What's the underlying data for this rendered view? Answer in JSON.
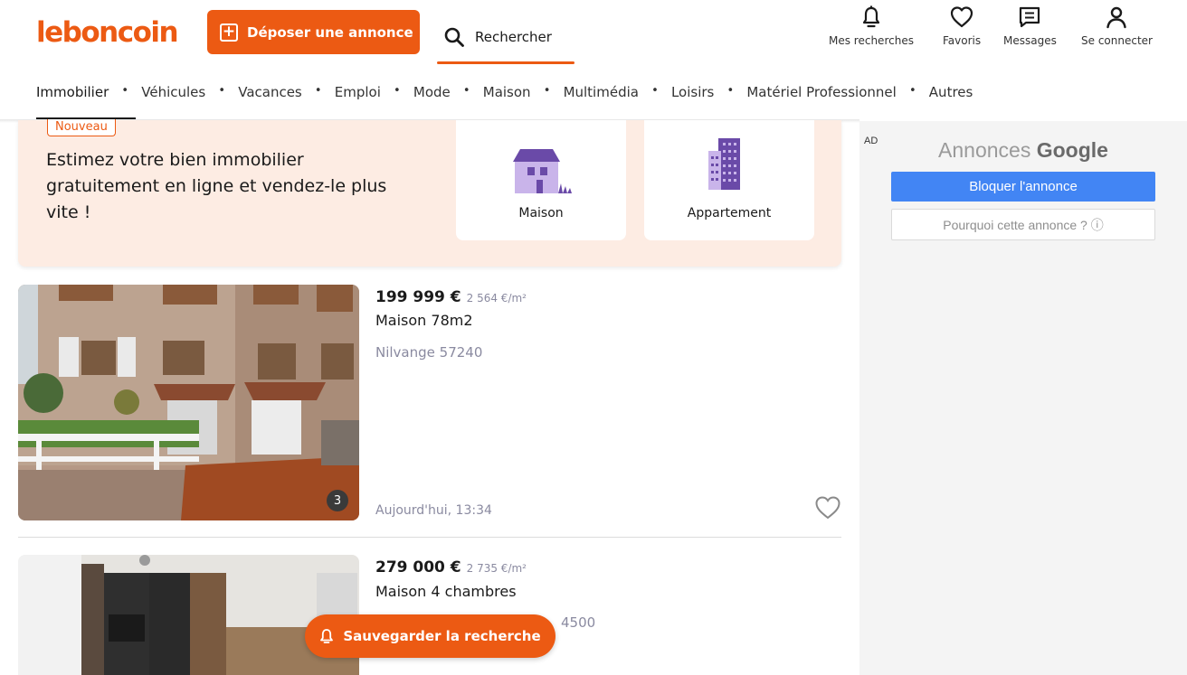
{
  "header": {
    "logo": "leboncoin",
    "post_button": "Déposer une annonce",
    "search_tab": "Rechercher",
    "actions": [
      {
        "label": "Mes recherches",
        "icon": "bell-icon"
      },
      {
        "label": "Favoris",
        "icon": "heart-icon"
      },
      {
        "label": "Messages",
        "icon": "message-icon"
      },
      {
        "label": "Se connecter",
        "icon": "user-icon"
      }
    ]
  },
  "categories": [
    "Immobilier",
    "Véhicules",
    "Vacances",
    "Emploi",
    "Mode",
    "Maison",
    "Multimédia",
    "Loisirs",
    "Matériel Professionnel",
    "Autres"
  ],
  "category_separator": "•",
  "banner": {
    "badge": "Nouveau",
    "text": "Estimez votre bien immobilier gratuitement en ligne et vendez-le plus vite !",
    "cards": [
      {
        "label": "Maison",
        "icon": "house-icon"
      },
      {
        "label": "Appartement",
        "icon": "apartment-building-icon"
      }
    ]
  },
  "listings": [
    {
      "price": "199 999 €",
      "price_per_m2": "2 564 €/m²",
      "title": "Maison 78m2",
      "location": "Nilvange 57240",
      "date": "Aujourd'hui, 13:34",
      "photo_count": "3"
    },
    {
      "price": "279 000 €",
      "price_per_m2": "2 735 €/m²",
      "title": "Maison 4 chambres",
      "location_partial": "4500"
    }
  ],
  "ad": {
    "tag": "AD",
    "title_prefix": "Annonces",
    "title_brand": "Google",
    "block_button": "Bloquer l'annonce",
    "why_button": "Pourquoi cette annonce ? ⓘ"
  },
  "save_search": "Sauvegarder la recherche",
  "colors": {
    "brand": "#ec5a13",
    "banner_bg": "#fdece3",
    "google_blue": "#4285f4"
  }
}
